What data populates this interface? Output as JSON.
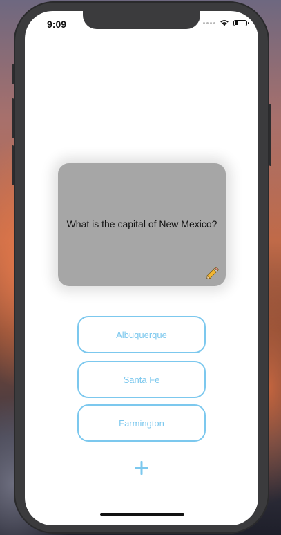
{
  "status_bar": {
    "time": "9:09"
  },
  "flashcard": {
    "question": "What is the capital of New Mexico?",
    "edit_icon": "pencil-icon"
  },
  "answers": [
    {
      "label": "Albuquerque"
    },
    {
      "label": "Santa Fe"
    },
    {
      "label": "Farmington"
    }
  ],
  "add_button": {
    "icon": "plus-icon"
  },
  "colors": {
    "accent": "#7cc8ee",
    "card": "#a6a6a6",
    "phone_frame": "#3b3b3d"
  }
}
